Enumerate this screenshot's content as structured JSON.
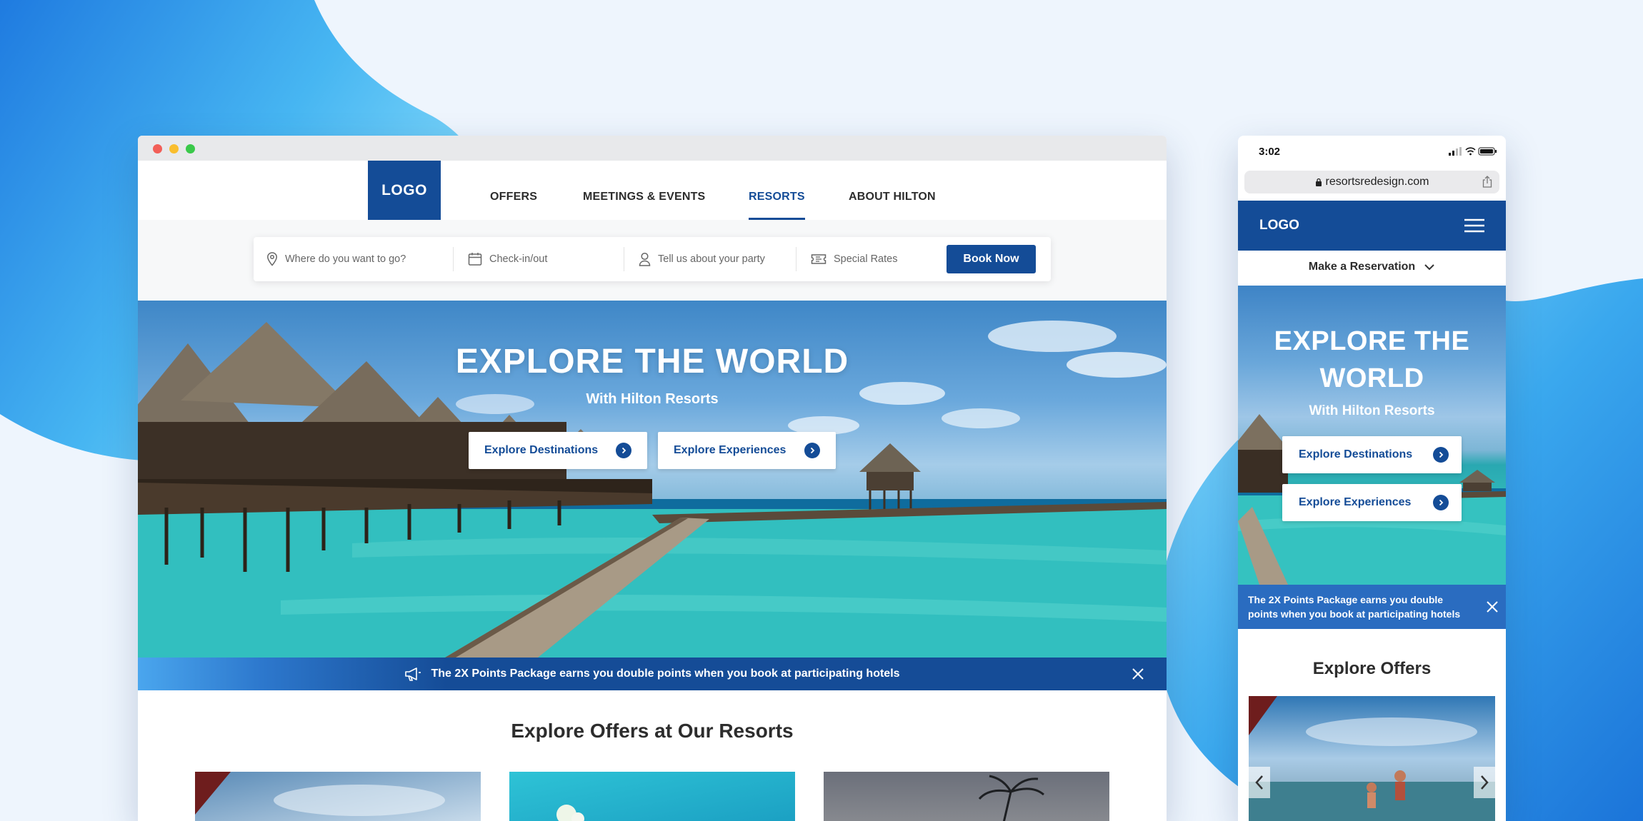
{
  "colors": {
    "brand_blue": "#144c97",
    "page_bg": "#eef5fd",
    "promo_blue": "#154c97",
    "white": "#ffffff"
  },
  "desktop": {
    "nav": {
      "logo": "LOGO",
      "items": [
        {
          "label": "OFFERS",
          "active": false
        },
        {
          "label": "MEETINGS & EVENTS",
          "active": false
        },
        {
          "label": "RESORTS",
          "active": true
        },
        {
          "label": "ABOUT HILTON",
          "active": false
        }
      ]
    },
    "search": {
      "destination_placeholder": "Where do you want to go?",
      "dates_placeholder": "Check-in/out",
      "party_placeholder": "Tell us about your party",
      "rates_label": "Special Rates",
      "book_label": "Book Now",
      "icons": [
        "location-pin-icon",
        "calendar-icon",
        "person-icon",
        "ticket-icon"
      ]
    },
    "hero": {
      "title": "EXPLORE THE WORLD",
      "subtitle": "With Hilton Resorts",
      "buttons": [
        {
          "label": "Explore Destinations",
          "icon": "chevron-right-icon"
        },
        {
          "label": "Explore Experiences",
          "icon": "chevron-right-icon"
        }
      ]
    },
    "promo": {
      "text": "The 2X Points Package earns you double points when you book at participating hotels",
      "icon": "megaphone-icon",
      "close_icon": "close-icon"
    },
    "offers": {
      "title": "Explore Offers at Our Resorts"
    }
  },
  "mobile": {
    "status_time": "3:02",
    "url": "resortsredesign.com",
    "logo": "LOGO",
    "reservation_label": "Make a Reservation",
    "hero": {
      "title": "EXPLORE THE WORLD",
      "subtitle": "With Hilton Resorts",
      "buttons": [
        {
          "label": "Explore Destinations"
        },
        {
          "label": "Explore Experiences"
        }
      ]
    },
    "promo": {
      "text": "The 2X Points Package earns you double points when you book at participating hotels"
    },
    "offers": {
      "title": "Explore Offers"
    }
  }
}
